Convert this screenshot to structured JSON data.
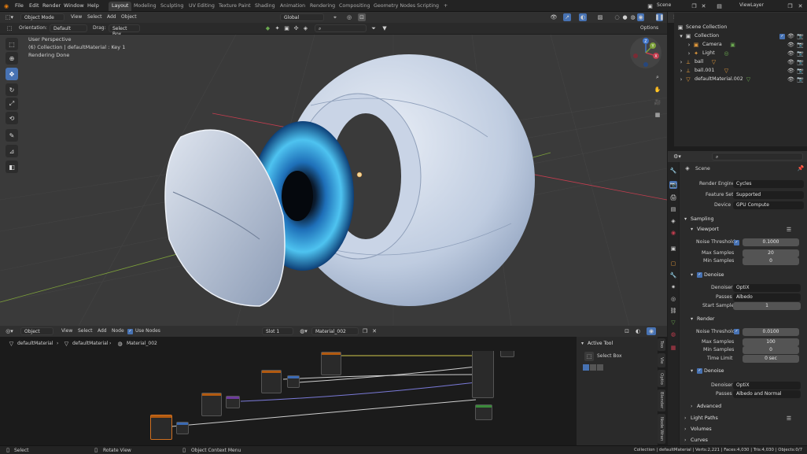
{
  "topbar": {
    "menus": [
      "File",
      "Edit",
      "Render",
      "Window",
      "Help"
    ],
    "workspaces": [
      "Layout",
      "Modeling",
      "Sculpting",
      "UV Editing",
      "Texture Paint",
      "Shading",
      "Animation",
      "Rendering",
      "Compositing",
      "Geometry Nodes",
      "Scripting"
    ],
    "active_workspace": "Layout",
    "add_tab": "+",
    "scene": "Scene",
    "view_layer": "ViewLayer"
  },
  "viewport_header": {
    "mode": "Object Mode",
    "menus": [
      "View",
      "Select",
      "Add",
      "Object"
    ],
    "transform_orientation": "Global",
    "orientation_label": "Orientation:",
    "orientation_value": "Default",
    "drag_label": "Drag:",
    "drag_value": "Select Box",
    "options": "Options"
  },
  "viewport_overlay": {
    "perspective": "User Perspective",
    "collection_info": "(6) Collection | defaultMaterial : Key 1",
    "render_status": "Rendering Done"
  },
  "gizmo": {
    "x": "X",
    "y": "Y",
    "z": "Z"
  },
  "node_editor": {
    "type": "Object",
    "menus": [
      "View",
      "Select",
      "Add",
      "Node"
    ],
    "use_nodes": "Use Nodes",
    "slot": "Slot 1",
    "material": "Material_002",
    "breadcrumb": [
      "defaultMaterial",
      "defaultMaterial",
      "Material_002"
    ]
  },
  "tool_panel": {
    "title": "Active Tool",
    "tool": "Select Box",
    "tabs": [
      "Too",
      "Vie",
      "Optio",
      "Blender",
      "Node Wran"
    ]
  },
  "outliner": {
    "root": "Scene Collection",
    "items": [
      {
        "name": "Collection",
        "indent": 1
      },
      {
        "name": "Camera",
        "indent": 2
      },
      {
        "name": "Light",
        "indent": 2
      },
      {
        "name": "ball",
        "indent": 1
      },
      {
        "name": "ball.001",
        "indent": 1
      },
      {
        "name": "defaultMaterial.002",
        "indent": 1
      }
    ]
  },
  "properties": {
    "scene_label": "Scene",
    "render_engine_label": "Render Engine",
    "render_engine": "Cycles",
    "feature_set_label": "Feature Set",
    "feature_set": "Supported",
    "device_label": "Device",
    "device": "GPU Compute",
    "sampling": "Sampling",
    "viewport": "Viewport",
    "vp_noise_label": "Noise Threshold",
    "vp_noise": "0.1000",
    "vp_max_label": "Max Samples",
    "vp_max": "20",
    "vp_min_label": "Min Samples",
    "vp_min": "0",
    "denoise": "Denoise",
    "vp_denoiser_label": "Denoiser",
    "vp_denoiser": "OptiX",
    "vp_passes_label": "Passes",
    "vp_passes": "Albedo",
    "start_sample_label": "Start Sample",
    "start_sample": "1",
    "render": "Render",
    "r_noise_label": "Noise Threshold",
    "r_noise": "0.0100",
    "r_max_label": "Max Samples",
    "r_max": "100",
    "r_min_label": "Min Samples",
    "r_min": "0",
    "time_limit_label": "Time Limit",
    "time_limit": "0 sec",
    "r_denoise": "Denoise",
    "r_denoiser_label": "Denoiser",
    "r_denoiser": "OptiX",
    "r_passes_label": "Passes",
    "r_passes": "Albedo and Normal",
    "advanced": "Advanced",
    "light_paths": "Light Paths",
    "volumes": "Volumes",
    "curves": "Curves"
  },
  "statusbar": {
    "select": "Select",
    "rotate": "Rotate View",
    "context": "Object Context Menu",
    "stats": "Collection | defaultMaterial | Verts:2,221 | Faces:4,030 | Tris:4,030 | Objects:0/7"
  },
  "colors": {
    "accent": "#4772b3",
    "x_axis": "#c43d4f",
    "y_axis": "#7da13a",
    "z_axis": "#3f74c9"
  }
}
